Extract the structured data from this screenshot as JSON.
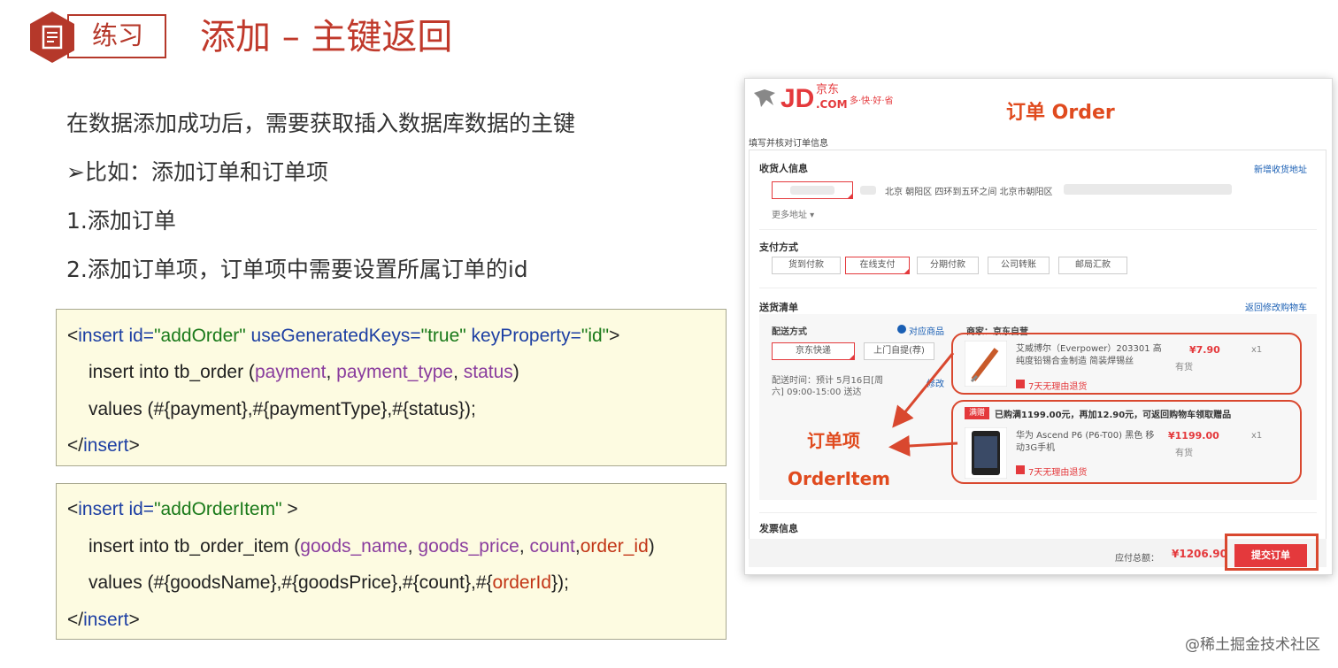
{
  "header": {
    "tag": "练习",
    "title": "添加 – 主键返回"
  },
  "bullets": [
    "在数据添加成功后，需要获取插入数据库数据的主键",
    "➢比如：添加订单和订单项",
    "1.添加订单",
    "2.添加订单项，订单项中需要设置所属订单的id"
  ],
  "code1": {
    "l1_open": "<",
    "l1_tag": "insert",
    "l1_a1": " id=",
    "l1_v1": "\"addOrder\"",
    "l1_a2": " useGeneratedKeys=",
    "l1_v2": "\"true\"",
    "l1_a3": " keyProperty=",
    "l1_v3": "\"id\"",
    "l1_close": ">",
    "l2_a": "insert into tb_order (",
    "l2_c1": "payment",
    "l2_s1": ", ",
    "l2_c2": "payment_type",
    "l2_s2": ", ",
    "l2_c3": "status",
    "l2_e": ")",
    "l3": "values (#{payment},#{paymentType},#{status});",
    "l4_open": "</",
    "l4_tag": "insert",
    "l4_close": ">"
  },
  "code2": {
    "l1_open": "<",
    "l1_tag": "insert",
    "l1_a1": " id=",
    "l1_v1": "\"addOrderItem\"",
    "l1_close": " >",
    "l2_a": "insert into tb_order_item (",
    "l2_c1": "goods_name",
    "l2_s1": ", ",
    "l2_c2": "goods_price",
    "l2_s2": ", ",
    "l2_c3": "count",
    "l2_s3": ",",
    "l2_c4": "order_id",
    "l2_e": ")",
    "l3_a": "values (#{goodsName},#{goodsPrice},#{count},#{",
    "l3_r": "orderId",
    "l3_e": "});",
    "l4_open": "</",
    "l4_tag": "insert",
    "l4_close": ">"
  },
  "jd": {
    "logo": "JD",
    "logo_com": ".COM",
    "logo_cn": "京东",
    "slogan": "多·快·好·省",
    "annot_order": "订单 Order",
    "fill_title": "填写并核对订单信息",
    "receiver": "收货人信息",
    "new_address": "新增收货地址",
    "address": "北京 朝阳区 四环到五环之间 北京市朝阳区",
    "more_address": "更多地址 ▾",
    "pay_title": "支付方式",
    "pay_options": [
      "货到付款",
      "在线支付",
      "分期付款",
      "公司转账",
      "邮局汇款"
    ],
    "list_title": "送货清单",
    "back_cart": "返回修改购物车",
    "delivery": "配送方式",
    "for_goods": "对应商品",
    "seller": "商家：京东自营",
    "ship1": "京东快递",
    "ship2": "上门自提(荐)",
    "ship_time": "配送时间：预计 5月16日[周六] 09:00-15:00 送达",
    "edit": "修改",
    "item1_name": "艾威博尔（Everpower）203301 高纯度铅锡合金制造 简装焊锡丝",
    "item1_price": "¥7.90",
    "item1_qty": "x1",
    "item1_stock": "有货",
    "return_policy": "7天无理由退货",
    "promo_tag": "满赠",
    "promo_text": "已购满1199.00元，再加12.90元，可返回购物车领取赠品",
    "item2_name": "华为 Ascend P6 (P6-T00) 黑色 移动3G手机",
    "item2_price": "¥1199.00",
    "item2_qty": "x1",
    "item2_stock": "有货",
    "annot_item_cn": "订单项",
    "annot_item_en": "OrderItem",
    "invoice": "发票信息",
    "total_label": "应付总额：",
    "total": "¥1206.90",
    "submit": "提交订单"
  },
  "watermark": "@稀土掘金技术社区"
}
